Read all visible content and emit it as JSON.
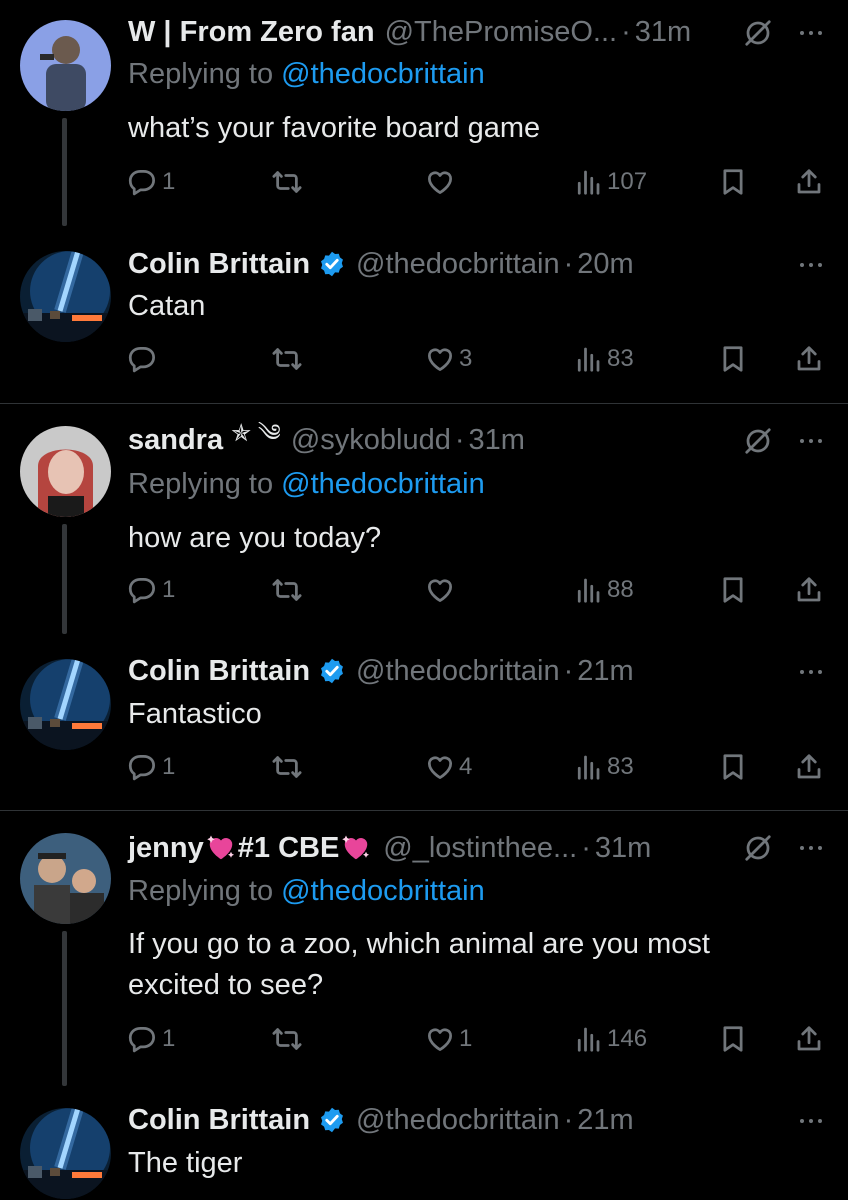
{
  "threads": [
    {
      "question": {
        "name": "W | From Zero fan",
        "handle": "@ThePromiseO...",
        "time": "31m",
        "replying_label": "Replying to",
        "replying_to": "@thedocbrittain",
        "text": "what’s your favorite board game",
        "replies": "1",
        "likes": "",
        "views": "107"
      },
      "answer": {
        "name": "Colin Brittain",
        "handle": "@thedocbrittain",
        "time": "20m",
        "text": "Catan",
        "replies": "",
        "likes": "3",
        "views": "83"
      }
    },
    {
      "question": {
        "name": "sandra",
        "name_symbols": "✯ ༄",
        "handle": "@sykobludd",
        "time": "31m",
        "replying_label": "Replying to",
        "replying_to": "@thedocbrittain",
        "text": "how are you today?",
        "replies": "1",
        "likes": "",
        "views": "88"
      },
      "answer": {
        "name": "Colin Brittain",
        "handle": "@thedocbrittain",
        "time": "21m",
        "text": "Fantastico",
        "replies": "1",
        "likes": "4",
        "views": "83"
      }
    },
    {
      "question": {
        "name": "jenny",
        "name_suffix": "#1 CBE",
        "handle": "@_lostinthee...",
        "time": "31m",
        "replying_label": "Replying to",
        "replying_to": "@thedocbrittain",
        "text": "If you go to a zoo, which animal are you most excited to see?",
        "replies": "1",
        "likes": "1",
        "views": "146"
      },
      "answer": {
        "name": "Colin Brittain",
        "handle": "@thedocbrittain",
        "time": "21m",
        "text": "The tiger"
      }
    }
  ],
  "colors": {
    "background": "#000000",
    "accent": "#1d9bf0",
    "muted": "#71767b",
    "text": "#e7e9ea",
    "emoji": "#e8459a"
  },
  "icons": [
    "reply-icon",
    "retweet-icon",
    "like-icon",
    "views-icon",
    "bookmark-icon",
    "share-icon",
    "more-icon",
    "verified-icon",
    "muted-icon"
  ]
}
